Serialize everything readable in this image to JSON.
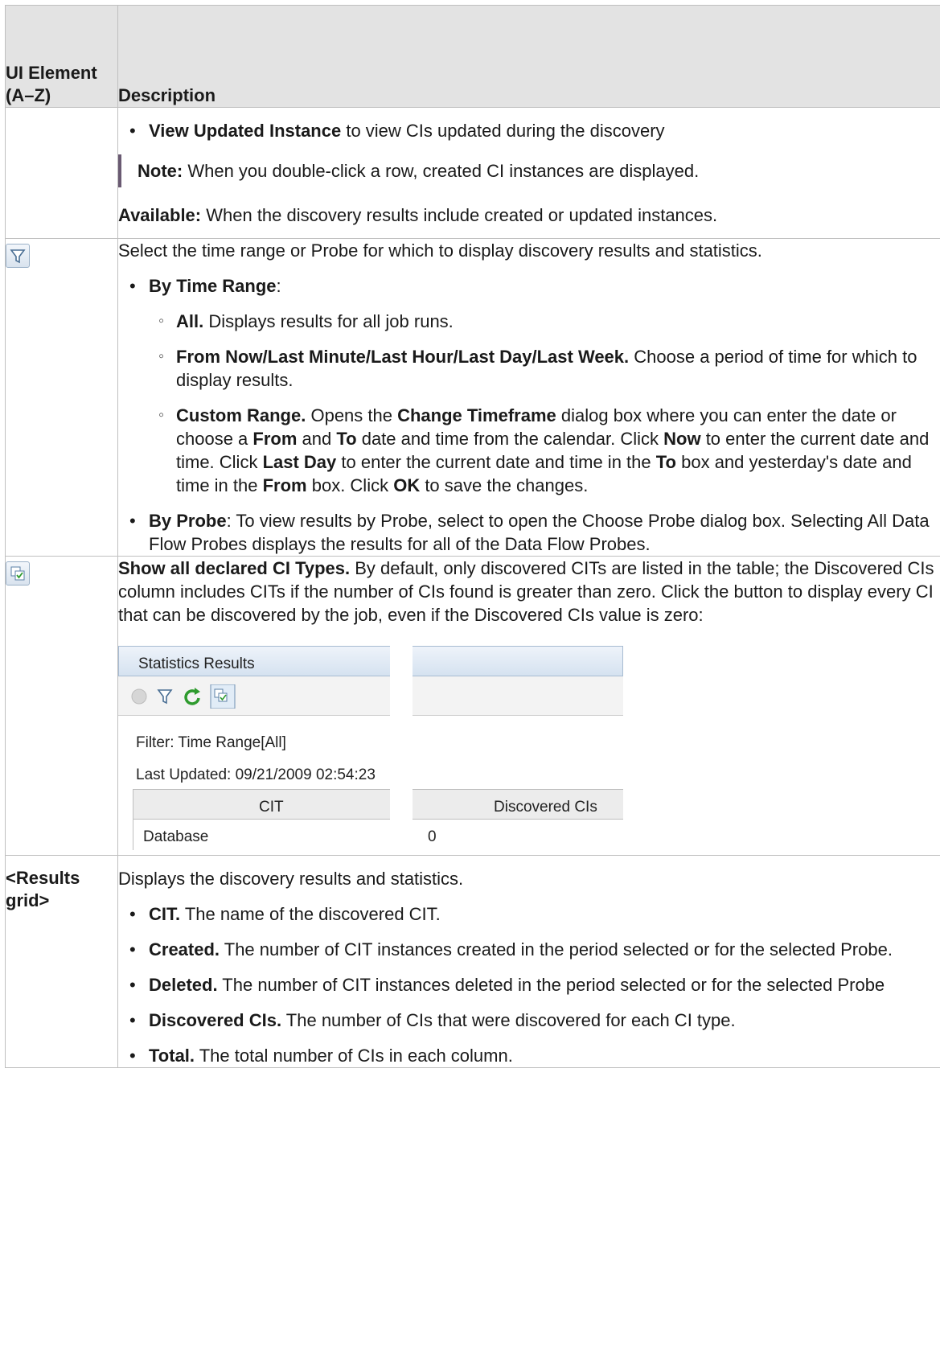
{
  "header": {
    "col1": "UI Element (A–Z)",
    "col2": "Description"
  },
  "row1": {
    "bullet_bold": "View Updated Instance",
    "bullet_rest": " to view CIs updated during the discovery",
    "note_bold": "Note:",
    "note_rest": "  When you double-click a row, created CI instances are displayed.",
    "avail_bold": "Available:",
    "avail_rest": " When the discovery results include created or updated instances."
  },
  "row2": {
    "icon": "filter-icon",
    "intro": "Select the time range or Probe for which to display discovery results and statistics.",
    "by_time_bold": "By Time Range",
    "by_time_rest": ":",
    "all_bold": "All.",
    "all_rest": " Displays results for all job runs.",
    "from_bold": "From Now/Last Minute/Last Hour/Last Day/Last Week.",
    "from_rest": " Choose a period of time for which to display results.",
    "custom_bold": "Custom Range.",
    "custom_t1": " Opens the ",
    "custom_b1": "Change Timeframe",
    "custom_t2": " dialog box where you can enter the date or choose a ",
    "custom_b2": "From",
    "custom_t3": " and ",
    "custom_b3": "To",
    "custom_t4": " date and time from the calendar. Click ",
    "custom_b4": "Now",
    "custom_t5": " to enter the current date and time. Click ",
    "custom_b5": "Last Day",
    "custom_t6": " to enter the current date and time in the ",
    "custom_b6": "To",
    "custom_t7": " box and yesterday's date and time in the ",
    "custom_b7": "From",
    "custom_t8": " box. Click ",
    "custom_b8": "OK",
    "custom_t9": " to save the changes.",
    "probe_bold": "By Probe",
    "probe_rest": ": To view results by Probe, select to open the Choose Probe dialog box. Selecting All Data Flow Probes displays the results for all of the Data Flow Probes."
  },
  "row3": {
    "icon": "show-declared-types-icon",
    "bold": "Show all declared CI Types.",
    "rest": " By default, only discovered CITs are listed in the table; the Discovered CIs column includes CITs if the number of CIs found is greater than zero. Click the button to display every CI that can be discovered by the job, even if the Discovered CIs value is zero:",
    "screenshot": {
      "title": "Statistics Results",
      "filter": "Filter: Time Range[All]",
      "updated": "Last Updated: 09/21/2009 02:54:23",
      "col_cit": "CIT",
      "col_disc": "Discovered CIs",
      "row_cit": "Database",
      "row_val": "0",
      "colors": {
        "refresh": "#2e9b2e"
      }
    }
  },
  "row4": {
    "label": "<Results grid>",
    "intro": "Displays the discovery results and statistics.",
    "cit_bold": "CIT.",
    "cit_rest": " The name of the discovered CIT.",
    "created_bold": "Created.",
    "created_rest": " The number of CIT instances created in the period selected or for the selected Probe.",
    "deleted_bold": "Deleted.",
    "deleted_rest": " The number of CIT instances deleted in the period selected or for the selected Probe",
    "disc_bold": "Discovered CIs.",
    "disc_rest": " The number of CIs that were discovered for each CI type.",
    "total_bold": "Total.",
    "total_rest": " The total number of CIs in each column."
  }
}
